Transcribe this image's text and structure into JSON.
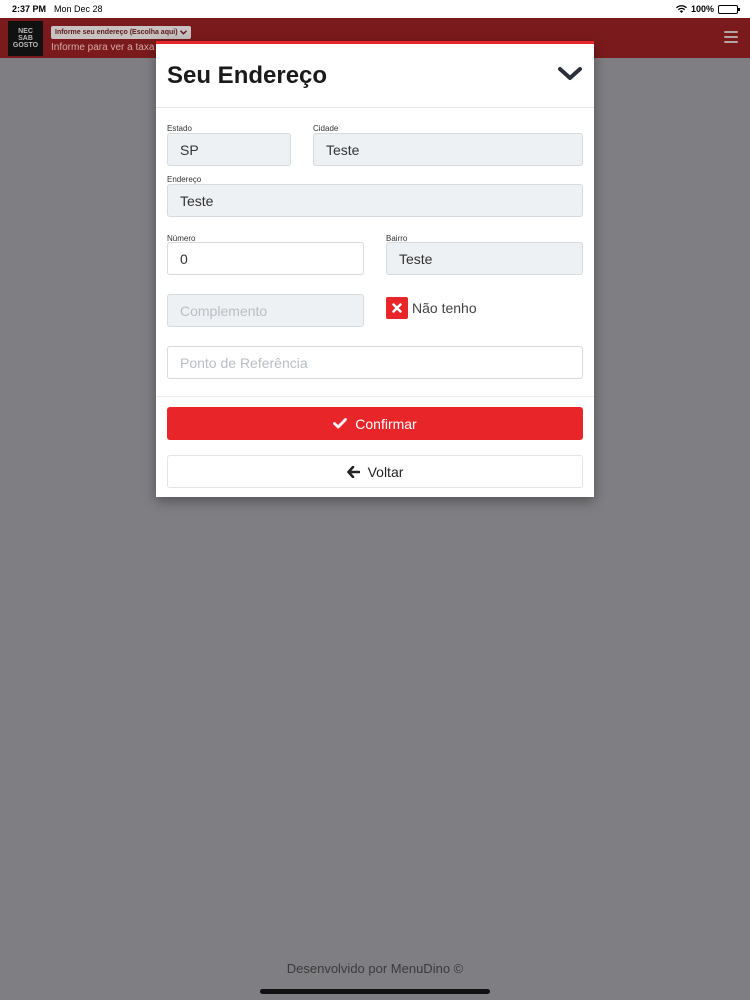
{
  "status_bar": {
    "time": "2:37 PM",
    "date": "Mon Dec 28",
    "battery": "100%"
  },
  "header": {
    "logo_lines": [
      "NEC",
      "SAB",
      "GOSTO"
    ],
    "address_select": "Informe seu endereço (Escolha aqui)",
    "subtitle": "Informe para ver a taxa"
  },
  "modal": {
    "title": "Seu Endereço",
    "fields": {
      "estado": {
        "label": "Estado",
        "value": "SP"
      },
      "cidade": {
        "label": "Cidade",
        "value": "Teste"
      },
      "endereco": {
        "label": "Endereço",
        "value": "Teste"
      },
      "numero": {
        "label": "Número",
        "value": "0"
      },
      "bairro": {
        "label": "Bairro",
        "value": "Teste"
      },
      "complemento": {
        "placeholder": "Complemento"
      },
      "referencia": {
        "placeholder": "Ponto de Referência"
      }
    },
    "no_complement_label": "Não tenho",
    "confirm_label": "Confirmar",
    "back_label": "Voltar"
  },
  "footer": {
    "text": "Desenvolvido por MenuDino ©"
  },
  "colors": {
    "accent": "#e8262a",
    "overlay": "#7f7e82"
  }
}
